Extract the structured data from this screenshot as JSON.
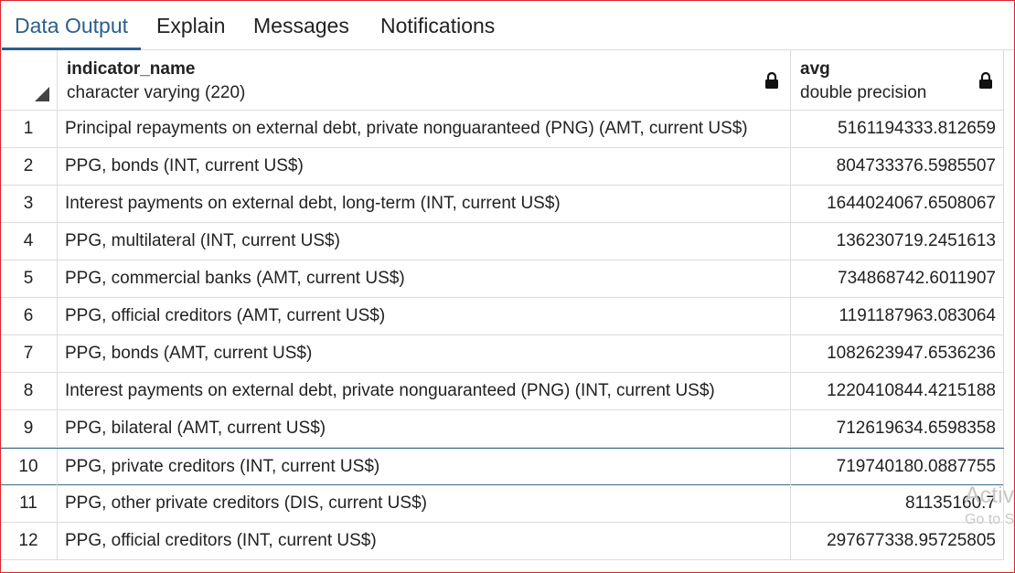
{
  "tabs": [
    {
      "label": "Data Output",
      "active": true
    },
    {
      "label": "Explain",
      "active": false
    },
    {
      "label": "Messages",
      "active": false
    },
    {
      "label": "Notifications",
      "active": false
    }
  ],
  "columns": [
    {
      "name": "indicator_name",
      "type": "character varying (220)",
      "icon": "lock-icon"
    },
    {
      "name": "avg",
      "type": "double precision",
      "icon": "lock-icon"
    }
  ],
  "rows": [
    {
      "num": "1",
      "indicator_name": "Principal repayments on external debt, private nonguaranteed (PNG) (AMT, current US$)",
      "avg": "5161194333.812659"
    },
    {
      "num": "2",
      "indicator_name": "PPG, bonds (INT, current US$)",
      "avg": "804733376.5985507"
    },
    {
      "num": "3",
      "indicator_name": "Interest payments on external debt, long-term (INT, current US$)",
      "avg": "1644024067.6508067"
    },
    {
      "num": "4",
      "indicator_name": "PPG, multilateral (INT, current US$)",
      "avg": "136230719.2451613"
    },
    {
      "num": "5",
      "indicator_name": "PPG, commercial banks (AMT, current US$)",
      "avg": "734868742.6011907"
    },
    {
      "num": "6",
      "indicator_name": "PPG, official creditors (AMT, current US$)",
      "avg": "1191187963.083064"
    },
    {
      "num": "7",
      "indicator_name": "PPG, bonds (AMT, current US$)",
      "avg": "1082623947.6536236"
    },
    {
      "num": "8",
      "indicator_name": "Interest payments on external debt, private nonguaranteed (PNG) (INT, current US$)",
      "avg": "1220410844.4215188"
    },
    {
      "num": "9",
      "indicator_name": "PPG, bilateral (AMT, current US$)",
      "avg": "712619634.6598358"
    },
    {
      "num": "10",
      "indicator_name": "PPG, private creditors (INT, current US$)",
      "avg": "719740180.0887755"
    },
    {
      "num": "11",
      "indicator_name": "PPG, other private creditors (DIS, current US$)",
      "avg": "81135160.7"
    },
    {
      "num": "12",
      "indicator_name": "PPG, official creditors (INT, current US$)",
      "avg": "297677338.95725805"
    }
  ],
  "selected_row": "10",
  "watermark": {
    "line1": "Activ",
    "line2": "Go to S"
  },
  "colors": {
    "accent": "#2c5f8a",
    "frame": "#d9262c",
    "grid_line": "#dcdcdc",
    "selection": "#3a6a88"
  }
}
